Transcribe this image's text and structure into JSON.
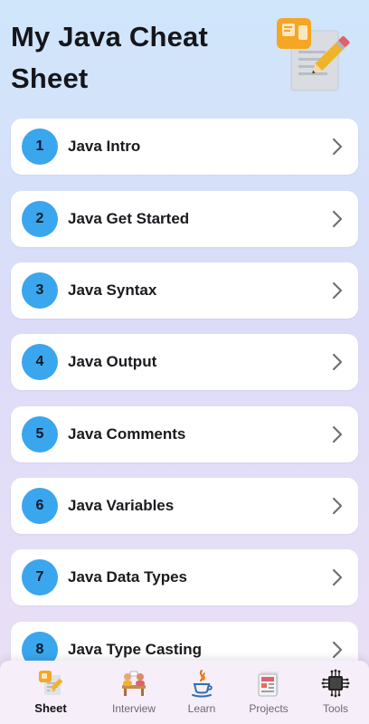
{
  "header": {
    "title": "My Java Cheat Sheet",
    "icon": "cheat-sheet-notepad-pencil-icon"
  },
  "topics": [
    {
      "number": "1",
      "label": "Java Intro"
    },
    {
      "number": "2",
      "label": "Java Get Started"
    },
    {
      "number": "3",
      "label": "Java Syntax"
    },
    {
      "number": "4",
      "label": "Java Output"
    },
    {
      "number": "5",
      "label": "Java Comments"
    },
    {
      "number": "6",
      "label": "Java Variables"
    },
    {
      "number": "7",
      "label": "Java Data Types"
    },
    {
      "number": "8",
      "label": "Java Type Casting"
    }
  ],
  "nav": {
    "active": "Sheet",
    "items": [
      {
        "label": "Sheet",
        "icon": "sheet-icon"
      },
      {
        "label": "Interview",
        "icon": "interview-icon"
      },
      {
        "label": "Learn",
        "icon": "java-cup-icon"
      },
      {
        "label": "Projects",
        "icon": "projects-icon"
      },
      {
        "label": "Tools",
        "icon": "ai-chip-icon"
      }
    ]
  },
  "colors": {
    "accent_circle": "#3aa6ee",
    "background_top": "#cfe6fb",
    "background_bottom": "#ece0f6",
    "card": "#ffffff",
    "nav_bar": "#f6eef8"
  }
}
